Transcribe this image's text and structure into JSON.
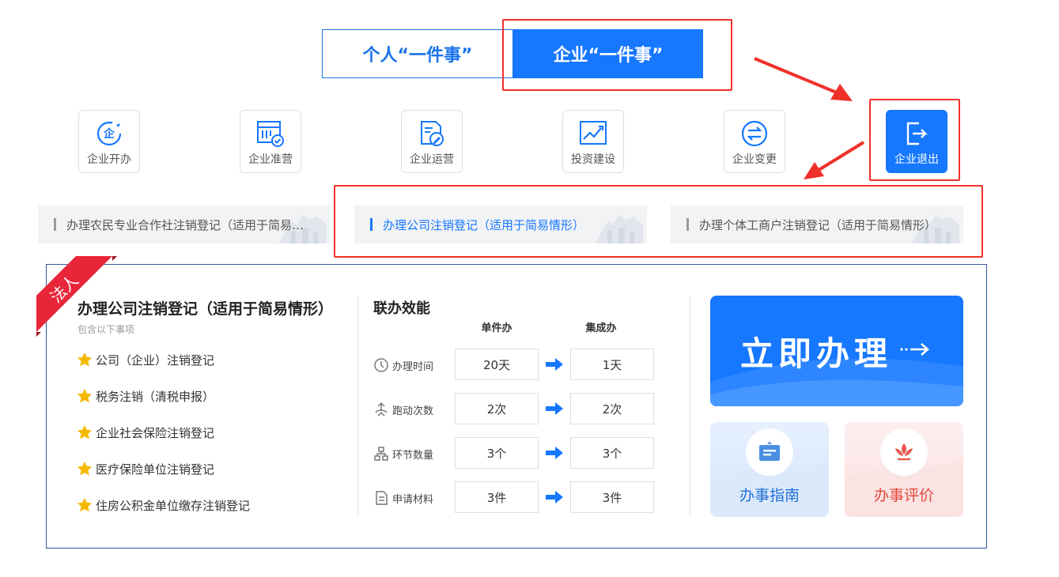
{
  "tabs": {
    "personal": "个人“一件事”",
    "enterprise": "企业“一件事”"
  },
  "categories": [
    {
      "label": "企业开办",
      "icon": "company-setup-icon"
    },
    {
      "label": "企业准营",
      "icon": "permit-icon"
    },
    {
      "label": "企业运营",
      "icon": "operation-icon"
    },
    {
      "label": "投资建设",
      "icon": "investment-chart-icon"
    },
    {
      "label": "企业变更",
      "icon": "change-icon"
    },
    {
      "label": "企业退出",
      "icon": "exit-icon"
    }
  ],
  "sub_items": [
    {
      "label": "办理农民专业合作社注销登记（适用于简易情形）"
    },
    {
      "label": "办理公司注销登记（适用于简易情形）"
    },
    {
      "label": "办理个体工商户注销登记（适用于简易情形）"
    }
  ],
  "detail": {
    "ribbon": "法人",
    "title": "办理公司注销登记（适用于简易情形）",
    "subtitle": "包含以下事项",
    "items": [
      "公司（企业）注销登记",
      "税务注销（清税申报）",
      "企业社会保险注销登记",
      "医疗保险单位注销登记",
      "住房公积金单位缴存注销登记"
    ]
  },
  "efficiency": {
    "title": "联办效能",
    "col_single": "单件办",
    "col_integrated": "集成办",
    "rows": [
      {
        "label": "办理时间",
        "single": "20天",
        "integrated": "1天"
      },
      {
        "label": "跑动次数",
        "single": "2次",
        "integrated": "2次"
      },
      {
        "label": "环节数量",
        "single": "3个",
        "integrated": "3个"
      },
      {
        "label": "申请材料",
        "single": "3件",
        "integrated": "3件"
      }
    ]
  },
  "actions": {
    "handle_now": "立即办理",
    "guide": "办事指南",
    "evaluate": "办事评价"
  },
  "colors": {
    "primary": "#1677ff",
    "highlight": "#f0302a",
    "guide_text": "#1f6fd6",
    "evaluate_text": "#e3483c"
  }
}
